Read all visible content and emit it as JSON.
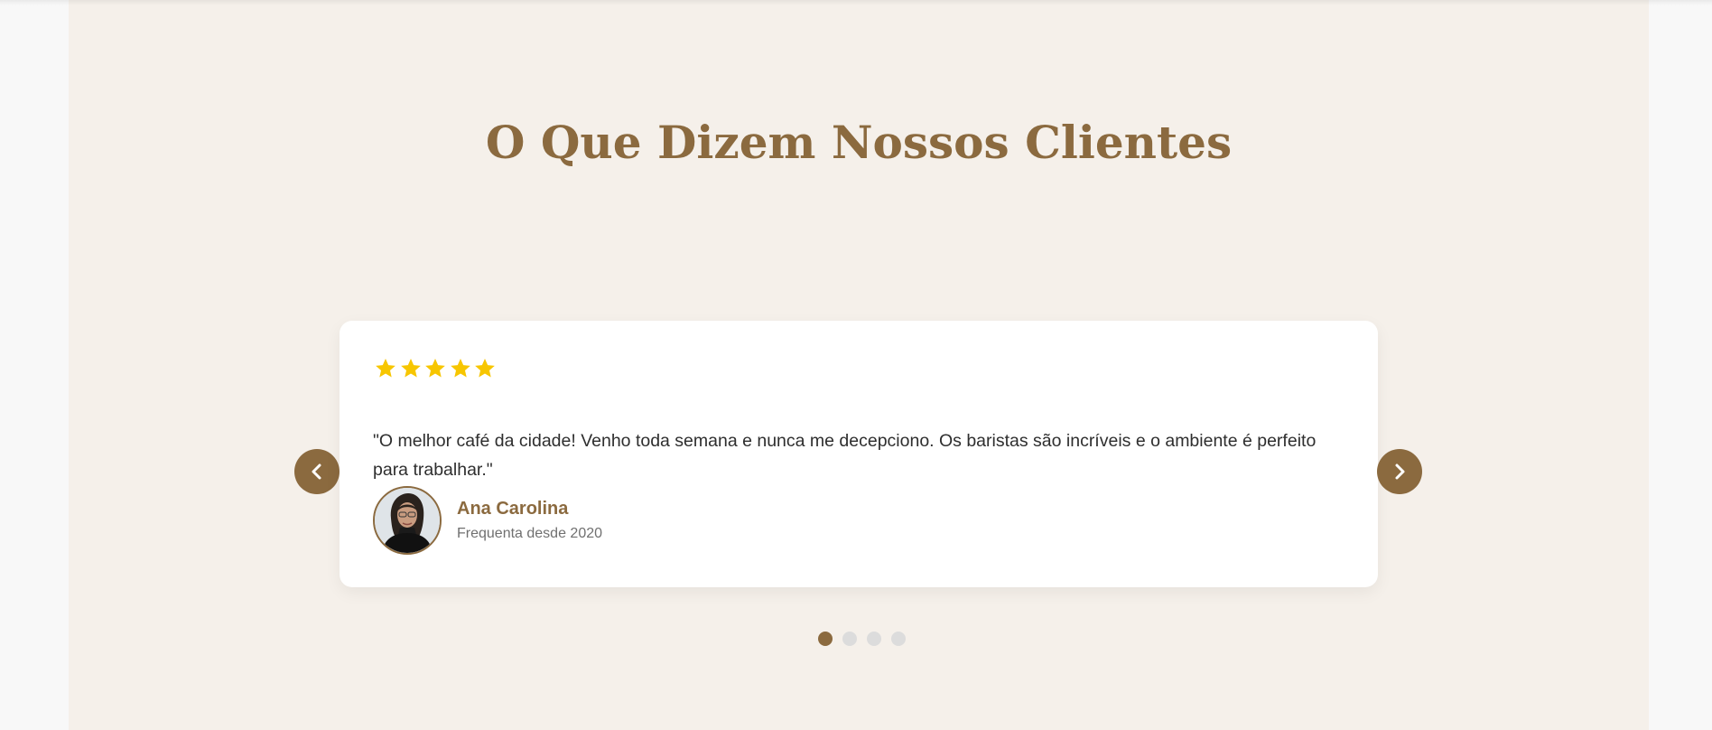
{
  "section": {
    "title": "O Que Dizem Nossos Clientes"
  },
  "testimonial": {
    "rating": 5,
    "rating_max": 5,
    "quote": "\"O melhor café da cidade! Venho toda semana e nunca me decepciono. Os baristas são incríveis e o ambiente é perfeito para trabalhar.\"",
    "author": {
      "name": "Ana Carolina",
      "meta": "Frequenta desde 2020"
    }
  },
  "carousel": {
    "prev_icon": "chevron-left-icon",
    "next_icon": "chevron-right-icon",
    "slide_count": 4,
    "active_index": 0
  },
  "colors": {
    "accent": "#8b6a3f",
    "section_background": "#f5f0ea",
    "star": "#f7c600",
    "dot_inactive": "#dcdcdc"
  }
}
